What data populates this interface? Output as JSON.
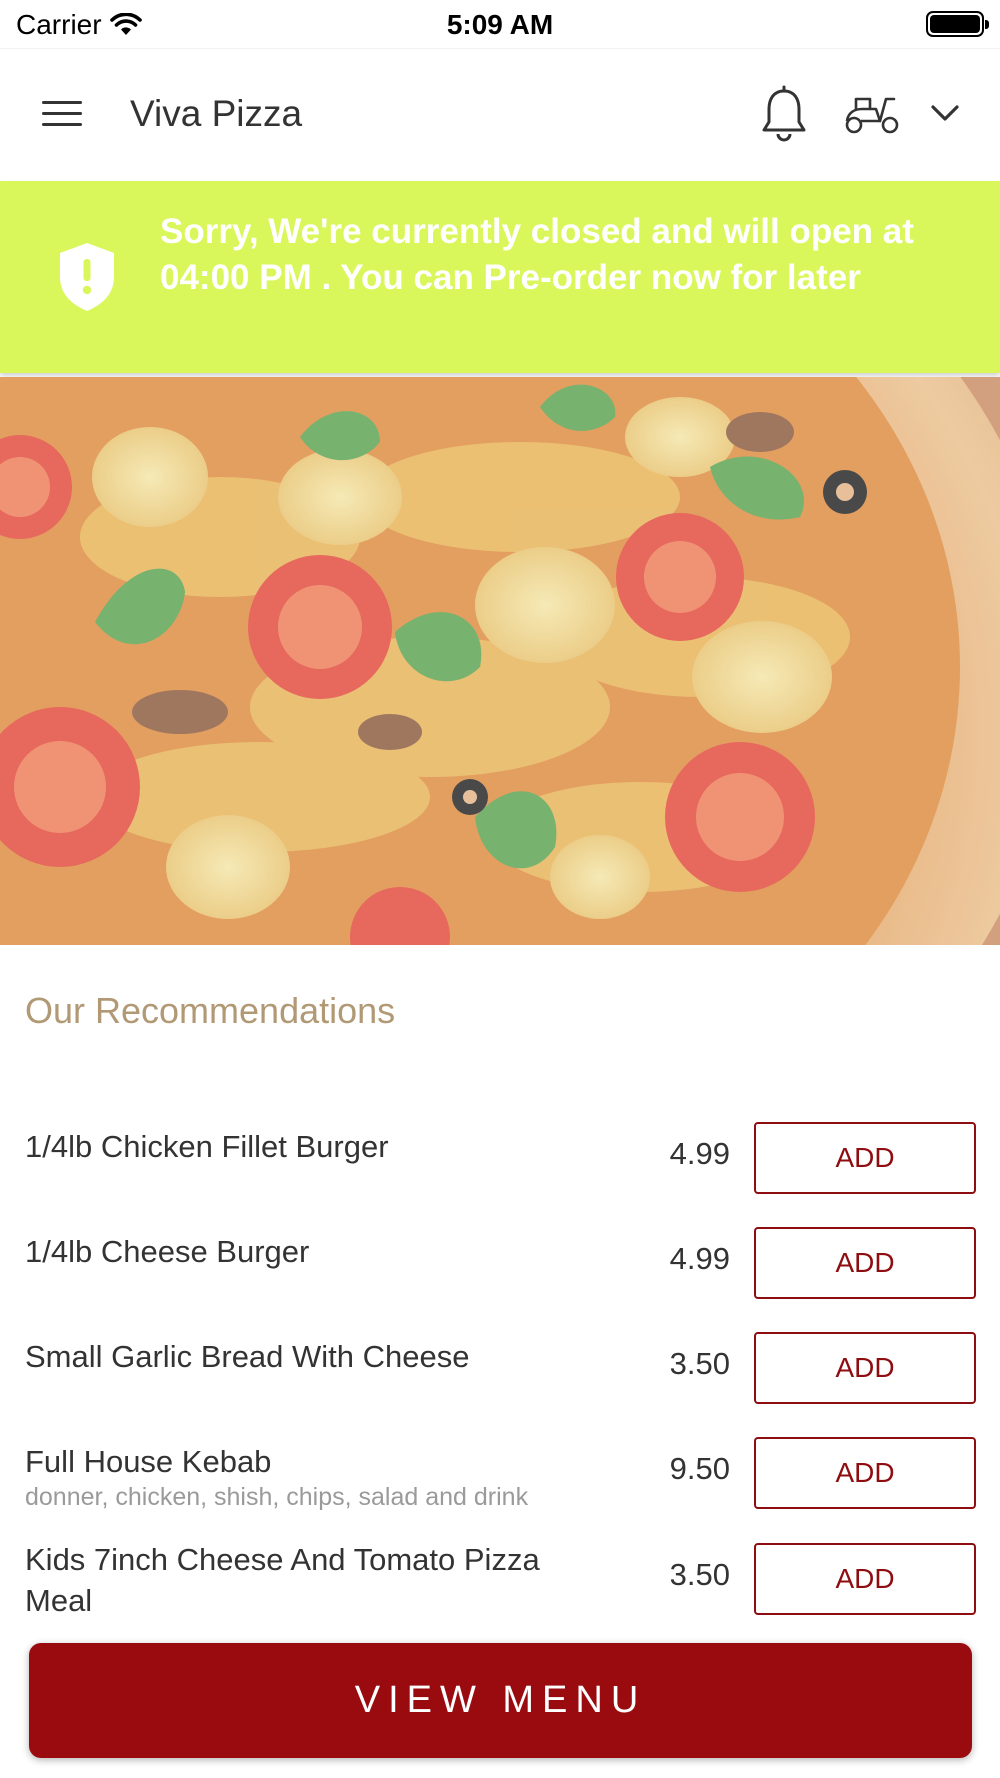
{
  "status_bar": {
    "carrier": "Carrier",
    "time": "5:09 AM"
  },
  "header": {
    "title": "Viva Pizza",
    "icons": [
      "menu-icon",
      "bell-icon",
      "scooter-icon",
      "chevron-down-icon"
    ]
  },
  "banner": {
    "message": "Sorry, We're currently closed and will open at 04:00 PM . You can Pre-order now for later",
    "icon": "shield-alert-icon",
    "background_color": "#d9f75a"
  },
  "hero": {
    "description": "pizza-photo"
  },
  "recommendations": {
    "title": "Our Recommendations",
    "items": [
      {
        "name": "1/4lb Chicken Fillet Burger",
        "description": "",
        "price": "4.99",
        "button": "ADD"
      },
      {
        "name": "1/4lb Cheese Burger",
        "description": "",
        "price": "4.99",
        "button": "ADD"
      },
      {
        "name": "Small Garlic Bread With Cheese",
        "description": "",
        "price": "3.50",
        "button": "ADD"
      },
      {
        "name": "Full House Kebab",
        "description": "donner, chicken, shish, chips, salad and drink",
        "price": "9.50",
        "button": "ADD"
      },
      {
        "name": "Kids 7inch Cheese And Tomato Pizza Meal",
        "description": "",
        "price": "3.50",
        "button": "ADD"
      }
    ]
  },
  "footer": {
    "view_menu_label": "VIEW MENU",
    "accent_color": "#9a0b10"
  }
}
